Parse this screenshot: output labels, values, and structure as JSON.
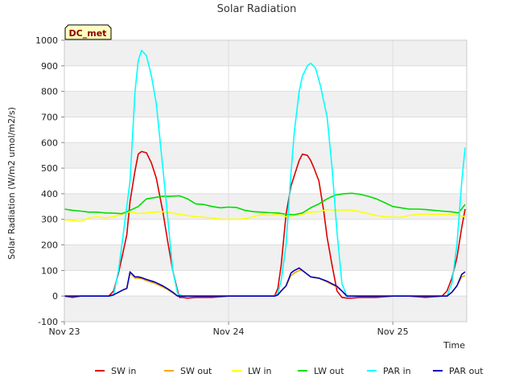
{
  "chart_data": {
    "type": "line",
    "title": "Solar Radiation",
    "xlabel": "Time",
    "ylabel": "Solar Radiation (W/m2 umol/m2/s)",
    "badge": "DC_met",
    "ylim": [
      -100,
      1000
    ],
    "yticks": [
      -100,
      0,
      100,
      200,
      300,
      400,
      500,
      600,
      700,
      800,
      900,
      1000
    ],
    "xlim": [
      0,
      2.45
    ],
    "xticks": [
      {
        "value": 0,
        "label": "Nov 23"
      },
      {
        "value": 1,
        "label": "Nov 24"
      },
      {
        "value": 2,
        "label": "Nov 25"
      }
    ],
    "grid": true,
    "legend_position": "bottom",
    "series": [
      {
        "name": "SW in",
        "color": "#dd0000",
        "x": [
          0,
          0.05,
          0.1,
          0.15,
          0.2,
          0.25,
          0.27,
          0.3,
          0.33,
          0.36,
          0.38,
          0.4,
          0.43,
          0.45,
          0.47,
          0.5,
          0.53,
          0.56,
          0.6,
          0.63,
          0.66,
          0.69,
          0.7,
          0.72,
          0.75,
          0.8,
          0.9,
          1.0,
          1.1,
          1.2,
          1.25,
          1.28,
          1.3,
          1.32,
          1.35,
          1.38,
          1.4,
          1.43,
          1.45,
          1.48,
          1.5,
          1.52,
          1.55,
          1.58,
          1.6,
          1.63,
          1.66,
          1.69,
          1.72,
          1.75,
          1.8,
          1.9,
          2.0,
          2.1,
          2.2,
          2.3,
          2.33,
          2.36,
          2.39,
          2.42,
          2.44
        ],
        "y": [
          0,
          -5,
          0,
          0,
          0,
          0,
          0,
          20,
          90,
          180,
          240,
          370,
          490,
          555,
          565,
          560,
          520,
          460,
          330,
          210,
          100,
          20,
          -5,
          -5,
          -8,
          -5,
          -5,
          0,
          0,
          0,
          0,
          0,
          30,
          120,
          320,
          430,
          470,
          530,
          555,
          550,
          530,
          500,
          450,
          330,
          230,
          120,
          20,
          -5,
          -8,
          -8,
          -5,
          -5,
          0,
          0,
          -5,
          0,
          20,
          70,
          150,
          270,
          340
        ]
      },
      {
        "name": "SW out",
        "color": "#ffa500",
        "x": [
          0,
          0.2,
          0.25,
          0.27,
          0.3,
          0.33,
          0.36,
          0.38,
          0.4,
          0.43,
          0.45,
          0.47,
          0.5,
          0.55,
          0.6,
          0.63,
          0.66,
          0.69,
          0.72,
          0.8,
          1.0,
          1.25,
          1.28,
          1.3,
          1.32,
          1.35,
          1.38,
          1.4,
          1.43,
          1.45,
          1.5,
          1.55,
          1.6,
          1.63,
          1.66,
          1.69,
          1.72,
          2.0,
          2.3,
          2.33,
          2.36,
          2.39,
          2.42,
          2.44
        ],
        "y": [
          0,
          0,
          0,
          0,
          5,
          15,
          25,
          30,
          90,
          70,
          70,
          68,
          60,
          50,
          35,
          25,
          12,
          0,
          0,
          0,
          0,
          0,
          0,
          5,
          20,
          40,
          80,
          90,
          100,
          100,
          75,
          70,
          55,
          45,
          35,
          20,
          0,
          0,
          0,
          0,
          15,
          40,
          75,
          80
        ]
      },
      {
        "name": "LW in",
        "color": "#ffff00",
        "x": [
          0,
          0.05,
          0.1,
          0.15,
          0.2,
          0.25,
          0.3,
          0.35,
          0.4,
          0.45,
          0.5,
          0.55,
          0.6,
          0.65,
          0.7,
          0.75,
          0.8,
          0.85,
          0.9,
          0.95,
          1.0,
          1.05,
          1.1,
          1.15,
          1.2,
          1.25,
          1.3,
          1.35,
          1.4,
          1.45,
          1.5,
          1.55,
          1.6,
          1.65,
          1.7,
          1.75,
          1.8,
          1.85,
          1.9,
          1.95,
          2.0,
          2.05,
          2.1,
          2.15,
          2.2,
          2.25,
          2.3,
          2.35,
          2.4,
          2.44
        ],
        "y": [
          298,
          296,
          292,
          305,
          310,
          305,
          310,
          320,
          330,
          322,
          325,
          328,
          330,
          325,
          320,
          315,
          310,
          308,
          305,
          300,
          300,
          300,
          302,
          310,
          318,
          315,
          320,
          310,
          315,
          320,
          328,
          330,
          338,
          336,
          337,
          336,
          330,
          322,
          315,
          310,
          308,
          308,
          315,
          320,
          320,
          320,
          320,
          318,
          315,
          310
        ]
      },
      {
        "name": "LW out",
        "color": "#00dd00",
        "x": [
          0,
          0.05,
          0.1,
          0.15,
          0.2,
          0.25,
          0.3,
          0.35,
          0.4,
          0.45,
          0.5,
          0.55,
          0.6,
          0.65,
          0.7,
          0.75,
          0.8,
          0.85,
          0.9,
          0.95,
          1.0,
          1.05,
          1.1,
          1.15,
          1.2,
          1.25,
          1.3,
          1.35,
          1.4,
          1.45,
          1.5,
          1.55,
          1.6,
          1.65,
          1.7,
          1.75,
          1.8,
          1.85,
          1.9,
          1.95,
          2.0,
          2.05,
          2.1,
          2.15,
          2.2,
          2.25,
          2.3,
          2.35,
          2.4,
          2.44
        ],
        "y": [
          340,
          335,
          332,
          328,
          328,
          325,
          324,
          322,
          335,
          350,
          380,
          385,
          390,
          390,
          392,
          380,
          360,
          358,
          350,
          345,
          348,
          346,
          335,
          330,
          328,
          326,
          325,
          320,
          318,
          325,
          345,
          360,
          380,
          395,
          400,
          402,
          398,
          390,
          380,
          365,
          350,
          345,
          340,
          340,
          338,
          335,
          332,
          330,
          325,
          358
        ]
      },
      {
        "name": "PAR in",
        "color": "#00ffff",
        "x": [
          0,
          0.2,
          0.25,
          0.28,
          0.3,
          0.33,
          0.36,
          0.4,
          0.43,
          0.45,
          0.47,
          0.5,
          0.53,
          0.56,
          0.6,
          0.63,
          0.66,
          0.69,
          0.72,
          0.8,
          1.0,
          1.25,
          1.28,
          1.3,
          1.32,
          1.35,
          1.38,
          1.4,
          1.43,
          1.45,
          1.48,
          1.5,
          1.53,
          1.56,
          1.6,
          1.63,
          1.66,
          1.69,
          1.72,
          2.0,
          2.3,
          2.33,
          2.36,
          2.39,
          2.42,
          2.44
        ],
        "y": [
          0,
          0,
          0,
          0,
          5,
          100,
          250,
          450,
          800,
          920,
          960,
          940,
          860,
          750,
          500,
          300,
          100,
          10,
          0,
          0,
          0,
          0,
          0,
          10,
          60,
          200,
          480,
          640,
          800,
          860,
          900,
          910,
          890,
          820,
          700,
          500,
          250,
          50,
          0,
          0,
          0,
          0,
          50,
          200,
          450,
          580
        ]
      },
      {
        "name": "PAR out",
        "color": "#0000bb",
        "x": [
          0,
          0.2,
          0.25,
          0.27,
          0.3,
          0.33,
          0.36,
          0.38,
          0.4,
          0.43,
          0.45,
          0.47,
          0.5,
          0.55,
          0.6,
          0.63,
          0.66,
          0.69,
          0.72,
          0.8,
          1.0,
          1.25,
          1.28,
          1.3,
          1.32,
          1.35,
          1.38,
          1.4,
          1.43,
          1.45,
          1.5,
          1.55,
          1.6,
          1.63,
          1.66,
          1.69,
          1.72,
          2.0,
          2.3,
          2.33,
          2.36,
          2.39,
          2.42,
          2.44
        ],
        "y": [
          0,
          0,
          0,
          0,
          5,
          15,
          25,
          30,
          95,
          75,
          75,
          72,
          65,
          55,
          40,
          28,
          15,
          0,
          0,
          0,
          0,
          0,
          0,
          5,
          20,
          40,
          90,
          100,
          110,
          100,
          75,
          70,
          58,
          48,
          38,
          20,
          0,
          0,
          0,
          0,
          15,
          40,
          85,
          95
        ]
      }
    ]
  }
}
